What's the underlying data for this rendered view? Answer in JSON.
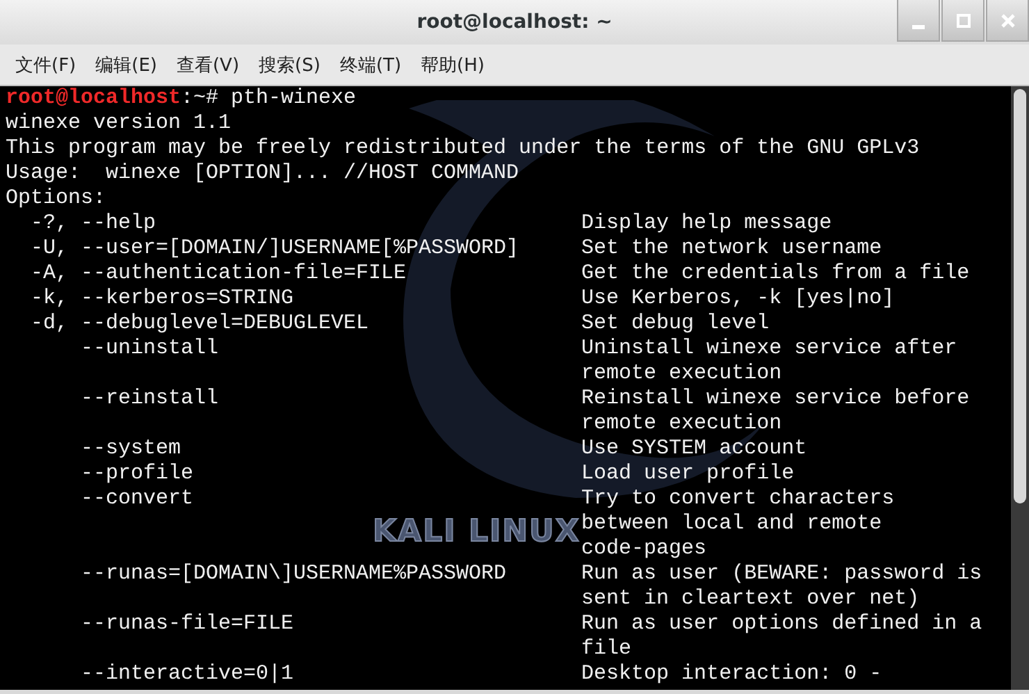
{
  "window": {
    "title": "root@localhost: ~"
  },
  "menu": [
    {
      "label": "文件(F)"
    },
    {
      "label": "编辑(E)"
    },
    {
      "label": "查看(V)"
    },
    {
      "label": "搜索(S)"
    },
    {
      "label": "终端(T)"
    },
    {
      "label": "帮助(H)"
    }
  ],
  "wallpaper": {
    "logo": "KALI LINUX"
  },
  "terminal": {
    "prompt_user": "root@localhost",
    "prompt_path": ":~# ",
    "command": "pth-winexe",
    "lines": [
      "winexe version 1.1",
      "This program may be freely redistributed under the terms of the GNU GPLv3",
      "Usage:  winexe [OPTION]... //HOST COMMAND",
      "Options:"
    ],
    "options": [
      {
        "short": "-?,",
        "long": "--help",
        "description": [
          "Display help message"
        ]
      },
      {
        "short": "-U,",
        "long": "--user=[DOMAIN/]USERNAME[%PASSWORD]",
        "description": [
          "Set the network username"
        ]
      },
      {
        "short": "-A,",
        "long": "--authentication-file=FILE",
        "description": [
          "Get the credentials from a file"
        ]
      },
      {
        "short": "-k,",
        "long": "--kerberos=STRING",
        "description": [
          "Use Kerberos, -k [yes|no]"
        ]
      },
      {
        "short": "-d,",
        "long": "--debuglevel=DEBUGLEVEL",
        "description": [
          "Set debug level"
        ]
      },
      {
        "long": "--uninstall",
        "description": [
          "Uninstall winexe service after",
          "remote execution"
        ]
      },
      {
        "long": "--reinstall",
        "description": [
          "Reinstall winexe service before",
          "remote execution"
        ]
      },
      {
        "long": "--system",
        "description": [
          "Use SYSTEM account"
        ]
      },
      {
        "long": "--profile",
        "description": [
          "Load user profile"
        ]
      },
      {
        "long": "--convert",
        "description": [
          "Try to convert characters",
          "between local and remote",
          "code-pages"
        ]
      },
      {
        "long": "--runas=[DOMAIN\\]USERNAME%PASSWORD",
        "description": [
          "Run as user (BEWARE: password is",
          "sent in cleartext over net)"
        ]
      },
      {
        "long": "--runas-file=FILE",
        "description": [
          "Run as user options defined in a",
          "file"
        ]
      },
      {
        "long": "--interactive=0|1",
        "description": [
          "Desktop interaction: 0 -"
        ]
      }
    ]
  }
}
